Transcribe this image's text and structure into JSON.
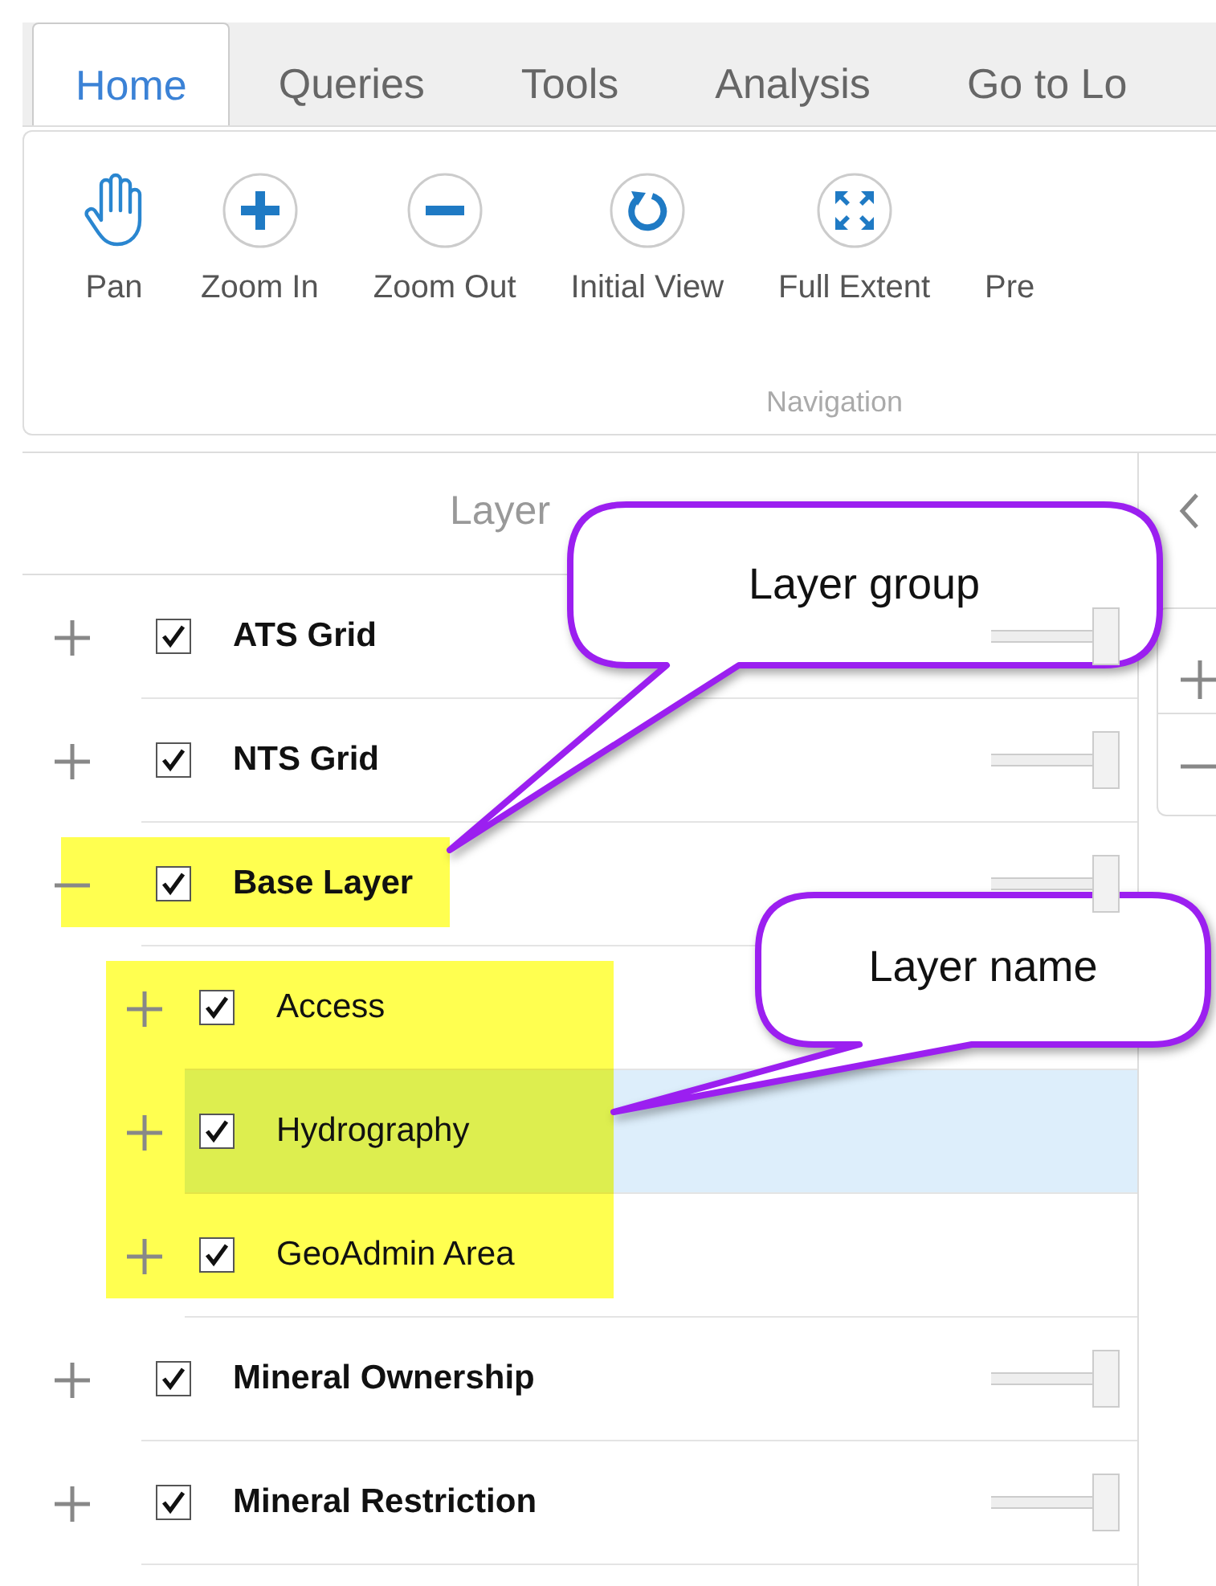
{
  "tabs": [
    {
      "label": "Home",
      "selected": true
    },
    {
      "label": "Queries",
      "selected": false
    },
    {
      "label": "Tools",
      "selected": false
    },
    {
      "label": "Analysis",
      "selected": false
    },
    {
      "label": "Go to Lo",
      "selected": false
    }
  ],
  "ribbon": {
    "tools": [
      {
        "kind": "pan",
        "label": "Pan"
      },
      {
        "kind": "zoom-in",
        "label": "Zoom In"
      },
      {
        "kind": "zoom-out",
        "label": "Zoom Out"
      },
      {
        "kind": "initial-view",
        "label": "Initial View"
      },
      {
        "kind": "full-extent",
        "label": "Full Extent"
      },
      {
        "kind": "plain",
        "label": "Pre"
      }
    ],
    "group_label": "Navigation"
  },
  "layer_panel": {
    "title": "Layer",
    "layers": [
      {
        "name": "ATS Grid",
        "expanded": false,
        "checked": true,
        "selected": false,
        "highlighted": false,
        "level": 1
      },
      {
        "name": "NTS Grid",
        "expanded": false,
        "checked": true,
        "selected": false,
        "highlighted": false,
        "level": 1
      },
      {
        "name": "Base Layer",
        "expanded": true,
        "checked": true,
        "selected": false,
        "highlighted": true,
        "level": 1,
        "children": [
          {
            "name": "Access",
            "expanded": false,
            "checked": true,
            "selected": false,
            "highlighted": true
          },
          {
            "name": "Hydrography",
            "expanded": false,
            "checked": true,
            "selected": true,
            "highlighted": true
          },
          {
            "name": "GeoAdmin Area",
            "expanded": false,
            "checked": true,
            "selected": false,
            "highlighted": true
          }
        ]
      },
      {
        "name": "Mineral Ownership",
        "expanded": false,
        "checked": true,
        "selected": false,
        "highlighted": false,
        "level": 1
      },
      {
        "name": "Mineral Restriction",
        "expanded": false,
        "checked": true,
        "selected": false,
        "highlighted": false,
        "level": 1
      }
    ]
  },
  "callouts": [
    {
      "text": "Layer group"
    },
    {
      "text": "Layer name"
    }
  ]
}
